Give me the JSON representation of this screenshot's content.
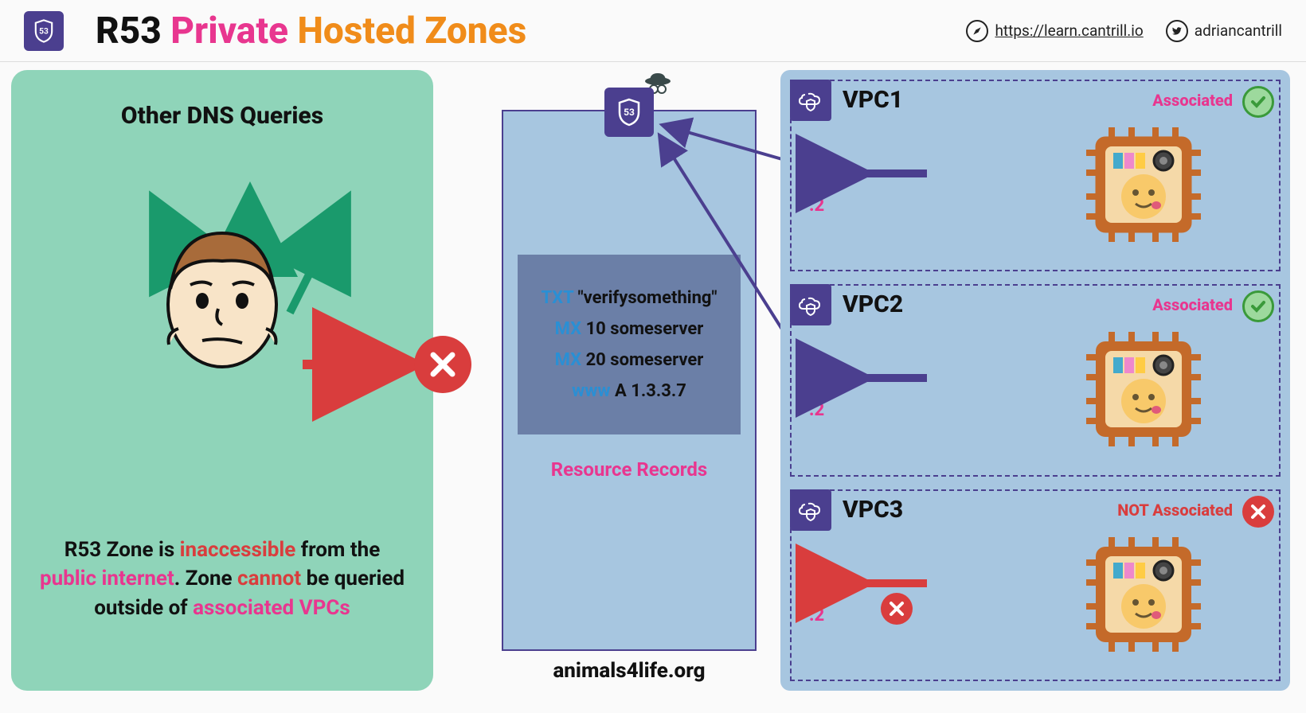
{
  "header": {
    "title_part1": "R53 ",
    "title_part2": "Private ",
    "title_part3": "Hosted Zones",
    "link_url": "https://learn.cantrill.io",
    "twitter_handle": "adriancantrill"
  },
  "left": {
    "heading": "Other DNS Queries",
    "text_p1": "R53 Zone is ",
    "text_inaccessible": "inaccessible",
    "text_p2": " from the ",
    "text_public": "public internet",
    "text_p3": ". Zone ",
    "text_cannot": "cannot",
    "text_p4": " be queried outside of ",
    "text_assoc": "associated VPCs"
  },
  "zone": {
    "records": [
      {
        "type": "TXT",
        "value": "\"verifysomething\""
      },
      {
        "type": "MX",
        "value": "10 someserver"
      },
      {
        "type": "MX",
        "value": "20 someserver"
      },
      {
        "type": "www",
        "value": "A 1.3.3.7"
      }
    ],
    "rr_label": "Resource Records",
    "zone_name": "animals4life.org"
  },
  "vpcs": [
    {
      "name": "VPC1",
      "status_text": "Associated",
      "status": "ok",
      "resolver": ".2"
    },
    {
      "name": "VPC2",
      "status_text": "Associated",
      "status": "ok",
      "resolver": ".2"
    },
    {
      "name": "VPC3",
      "status_text": "NOT Associated",
      "status": "no",
      "resolver": ".2"
    }
  ]
}
